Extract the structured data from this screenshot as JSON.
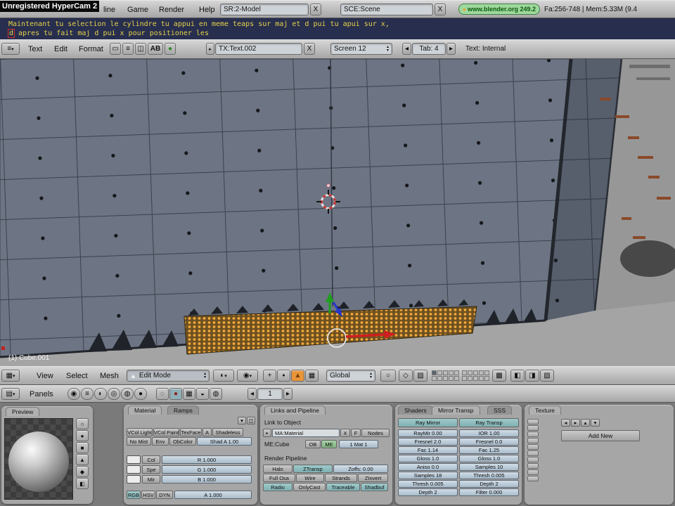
{
  "watermark": "Unregistered HyperCam 2",
  "top_bar": {
    "menus": [
      "line",
      "Game",
      "Render",
      "Help"
    ],
    "screen_value": "SR:2-Model",
    "scene_value": "SCE:Scene",
    "close": "X",
    "version": "www.blender.org 249.2",
    "stats": "Fa:256-748 | Mem:5.33M (9.4"
  },
  "console": {
    "line1": "Maintenant tu selection le cylindre tu appui en meme teaps sur maj et d pui tu apui sur x,",
    "cursor": "d",
    "line2": " apres tu fait maj d pui x pour positioner les"
  },
  "text_editor": {
    "menus": [
      "Text",
      "Edit",
      "Format"
    ],
    "ab": "AB",
    "datablock": "TX:Text.002",
    "close": "X",
    "screen": "Screen 12",
    "tab": "Tab: 4",
    "status": "Text: Internal"
  },
  "viewport": {
    "object_info": "(1) Cube.001"
  },
  "viewport_header": {
    "menus": [
      "View",
      "Select",
      "Mesh"
    ],
    "mode": "Edit Mode",
    "orientation": "Global"
  },
  "buttons_header": {
    "panels": "Panels",
    "frame": "1"
  },
  "preview_panel": {
    "title": "Preview"
  },
  "material_panel": {
    "tabs": [
      "Material",
      "Ramps"
    ],
    "toggles1": [
      "VCol Light",
      "VCol Paint",
      "TexFace",
      "A",
      "Shadeless"
    ],
    "toggles2": [
      "No Mist",
      "Env",
      "ObColor"
    ],
    "shad_a": "Shad A 1.00",
    "swatch_labels": [
      "Col",
      "Spe",
      "Mir"
    ],
    "rgb_sliders": [
      "R 1.000",
      "G 1.000",
      "B 1.000"
    ],
    "mode_toggles": [
      "RGB",
      "HSV",
      "DYN"
    ],
    "alpha": "A 1.000"
  },
  "links_panel": {
    "title": "Links and Pipeline",
    "link_to_object": "Link to Object",
    "ma": "MA:Material",
    "close": "X",
    "f": "F",
    "nodes": "Nodes",
    "me": "ME:Cube",
    "ob": "OB",
    "me_btn": "ME",
    "mat_count": "1 Mat 1",
    "render_pipeline": "Render Pipeline",
    "row1": [
      "Halo",
      "ZTransp",
      "Zoffs: 0.00"
    ],
    "row2": [
      "Full Osa",
      "Wire",
      "Strands",
      "ZInvert"
    ],
    "row3": [
      "Radio",
      "OnlyCast",
      "Traceable",
      "Shadbuf"
    ]
  },
  "shaders_panel": {
    "tabs": [
      "Shaders",
      "Mirror Transp",
      "SSS"
    ],
    "ray_mirror": "Ray Mirror",
    "ray_transp": "Ray Transp",
    "mirror_sliders": [
      "RayMir 0.00",
      "Fresnel 2.0",
      "Fac 1.14",
      "Gloss 1.0",
      "Aniso 0.0",
      "Samples 18",
      "Thresh 0.005",
      "Depth 2"
    ],
    "transp_sliders": [
      "IOR 1.00",
      "Fresnel 0.0",
      "Fac 1.25",
      "Gloss 1.0",
      "Samples 10",
      "Thresh 0.005",
      "Depth 2",
      "Filter 0.000"
    ]
  },
  "texture_panel": {
    "title": "Texture",
    "add_new": "Add New"
  },
  "colors": {
    "selection_orange": "#f2a83c",
    "console_bg": "#272e4e",
    "console_text": "#e6d24a",
    "version_green": "#9fd89f",
    "mesh_gray": "#6d7584"
  },
  "icons": {
    "dot": "●",
    "grid": "▦",
    "list": "≡",
    "panel_grid": "▤",
    "down": "▾",
    "up": "▴",
    "left": "◂",
    "right": "▸",
    "tri": "▲",
    "sphere": "◐",
    "target": "◉",
    "circle": "○",
    "plus": "+",
    "diamond": "◇",
    "lock": "▩",
    "half_l": "◧",
    "half_r": "◨",
    "shade": "▨",
    "hatch": "▧",
    "window": "◫",
    "blank": "▭",
    "ctx1": "◉",
    "ctx2": "≡",
    "ctx3": "◐",
    "ctx4": "◎",
    "ctx5": "◍",
    "ctx6": "●",
    "sub1": "◌",
    "sub2": "●",
    "sub3": "▦",
    "sub4": "◒",
    "sub5": "◍",
    "pv1": "○",
    "pv2": "●",
    "pv3": "■",
    "pv4": "▲",
    "pv5": "◆",
    "pv6": "◧"
  }
}
